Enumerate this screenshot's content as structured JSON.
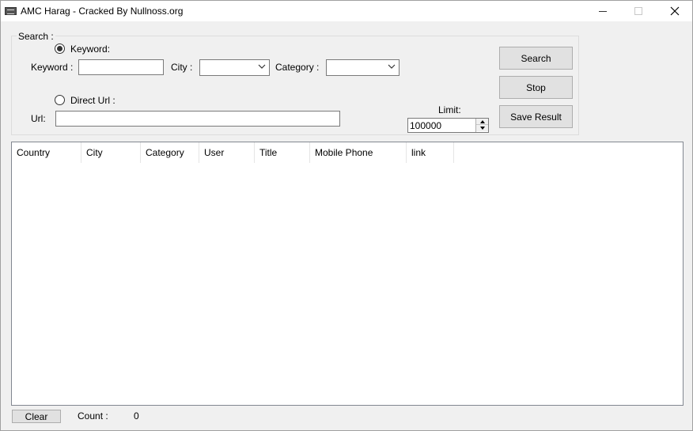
{
  "window": {
    "title": "AMC Harag - Cracked By Nullnoss.org"
  },
  "search_group": {
    "legend": "Search :",
    "keyword_radio_label": "Keyword:",
    "keyword_label": "Keyword :",
    "keyword_value": "",
    "city_label": "City :",
    "city_value": "",
    "category_label": "Category :",
    "category_value": "",
    "direct_url_radio_label": "Direct Url :",
    "url_label": "Url:",
    "url_value": "",
    "limit_label": "Limit:",
    "limit_value": "100000",
    "selected_mode": "keyword"
  },
  "buttons": {
    "search": "Search",
    "stop": "Stop",
    "save_result": "Save Result",
    "clear": "Clear"
  },
  "results": {
    "columns": [
      "Country",
      "City",
      "Category",
      "User",
      "Title",
      "Mobile Phone",
      "link"
    ],
    "rows": []
  },
  "footer": {
    "count_label": "Count :",
    "count_value": "0"
  }
}
